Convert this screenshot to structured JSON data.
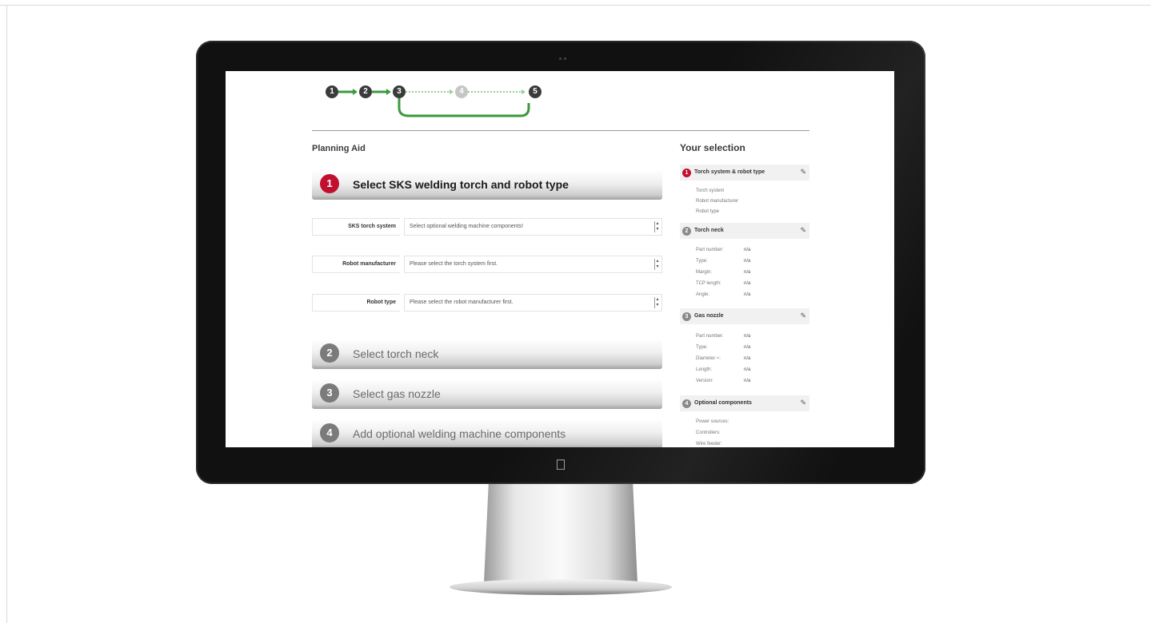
{
  "steps": [
    "1",
    "2",
    "3",
    "4",
    "5"
  ],
  "planning_title": "Planning Aid",
  "selection_title": "Your selection",
  "sections": [
    {
      "num": "1",
      "label": "Select SKS welding torch and robot type"
    },
    {
      "num": "2",
      "label": "Select torch neck"
    },
    {
      "num": "3",
      "label": "Select gas nozzle"
    },
    {
      "num": "4",
      "label": "Add optional welding machine components"
    }
  ],
  "form": [
    {
      "label": "SKS torch system",
      "value": "Select optional welding machine components!"
    },
    {
      "label": "Robot manufacturer",
      "value": "Please select the torch system first."
    },
    {
      "label": "Robot type",
      "value": "Please select the robot manufacturer first."
    }
  ],
  "sidebar": {
    "groups": [
      {
        "num": "1",
        "title": "Torch system & robot type",
        "items": [
          "Torch system",
          "Robot manufacturer",
          "Robot type"
        ],
        "values": []
      },
      {
        "num": "2",
        "title": "Torch neck",
        "items": [
          "Part number:",
          "Type:",
          "Margin:",
          "TCP length:",
          "Angle:"
        ],
        "values": [
          "n/a",
          "n/a",
          "n/a",
          "n/a",
          "n/a"
        ]
      },
      {
        "num": "3",
        "title": "Gas nozzle",
        "items": [
          "Part number:",
          "Type:",
          "Diameter ≈:",
          "Length:",
          "Version:"
        ],
        "values": [
          "n/a",
          "n/a",
          "n/a",
          "n/a",
          "n/a"
        ]
      },
      {
        "num": "4",
        "title": "Optional components",
        "items": [
          "Power sources:",
          "Controllers:",
          "Wire feeder:"
        ],
        "values": []
      }
    ]
  },
  "colors": {
    "accent": "#c20f2f",
    "progress_green": "#3c9a3c"
  }
}
